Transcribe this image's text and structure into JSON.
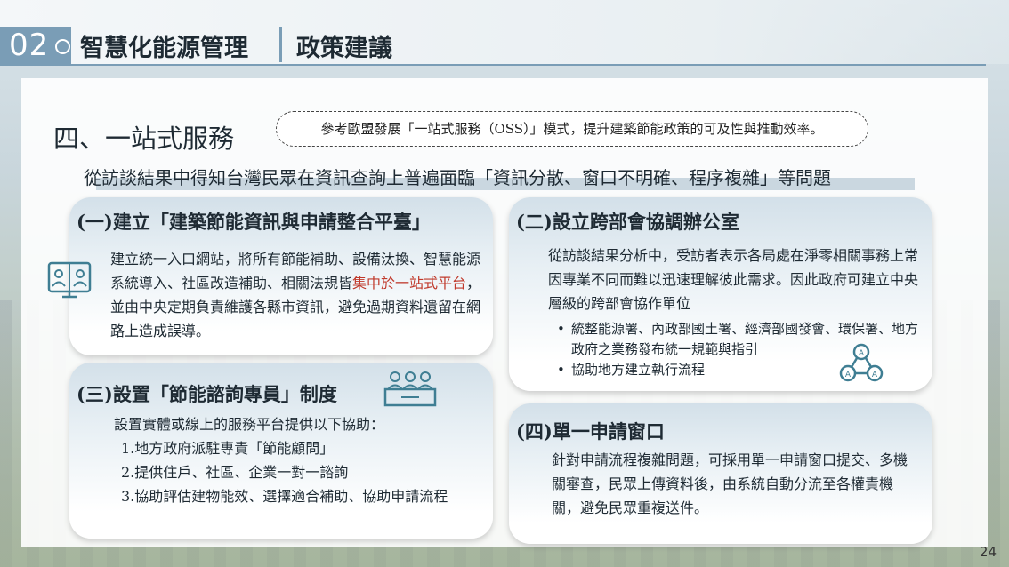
{
  "header": {
    "section_number": "02",
    "title": "智慧化能源管理",
    "subtitle": "政策建議"
  },
  "main": {
    "heading": "四、一站式服務",
    "pill_text": "參考歐盟發展「一站式服務（OSS）」模式，提升建築節能政策的可及性與推動效率。",
    "intro": "從訪談結果中得知台灣民眾在資訊查詢上普遍面臨「資訊分散、窗口不明確、程序複雜」等問題"
  },
  "cards": {
    "c1": {
      "title": "(一)建立「建築節能資訊與申請整合平臺」",
      "text_before": "建立統一入口網站，將所有節能補助、設備汰換、智慧能源系統導入、社區改造補助、相關法規皆",
      "text_highlight": "集中於一站式平台",
      "text_after": "，並由中央定期負責維護各縣市資訊，避免過期資料遺留在網路上造成誤導。",
      "icon": "video-meeting-icon"
    },
    "c2": {
      "title": "(二)設立跨部會協調辦公室",
      "text": "從訪談結果分析中，受訪者表示各局處在淨零相關事務上常因專業不同而難以迅速理解彼此需求。因此政府可建立中央層級的跨部會協作單位",
      "bullets": [
        "統整能源署、內政部國土署、經濟部國發會、環保署、地方政府之業務發布統一規範與指引",
        "協助地方建立執行流程"
      ],
      "icon": "team-network-icon"
    },
    "c3": {
      "title": "(三)設置「節能諮詢專員」制度",
      "intro": "設置實體或線上的服務平台提供以下協助：",
      "items": [
        "1.地方政府派駐專責「節能顧問」",
        "2.提供住戶、社區、企業一對一諮詢",
        "3.協助評估建物能效、選擇適合補助、協助申請流程"
      ],
      "icon": "consultation-desk-icon"
    },
    "c4": {
      "title": "(四)單一申請窗口",
      "text": "針對申請流程複雜問題，可採用單一申請窗口提交、多機關審查，民眾上傳資料後，由系統自動分流至各權責機關，避免民眾重複送件。"
    }
  },
  "footer": {
    "page_number": "24"
  },
  "colors": {
    "accent": "#7a9db6",
    "highlight": "#c0392b",
    "icon": "#3f7e93"
  }
}
